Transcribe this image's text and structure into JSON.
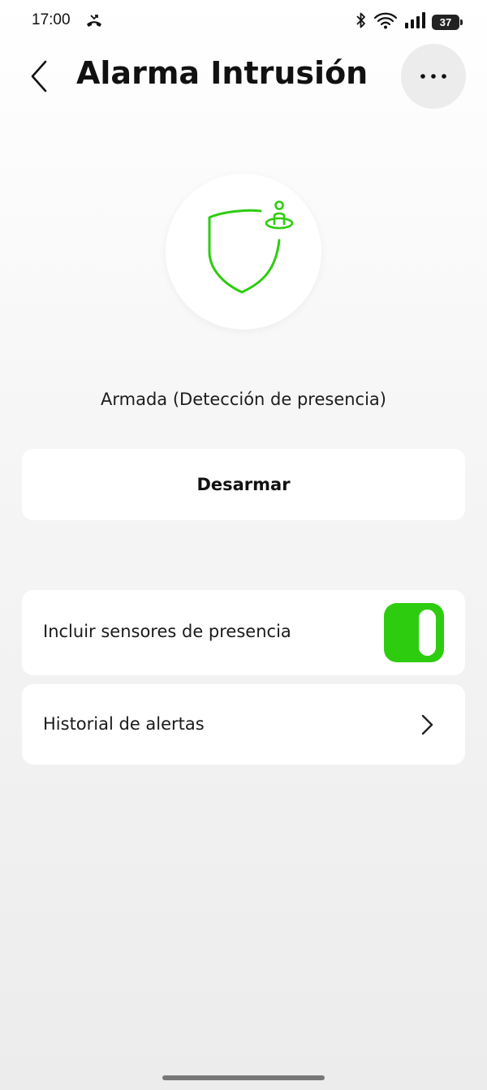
{
  "status_bar": {
    "time": "17:00",
    "battery_level": "37",
    "icons": [
      "missed-call-icon",
      "bluetooth-icon",
      "wifi-icon",
      "signal-icon",
      "battery-icon"
    ]
  },
  "header": {
    "title": "Alarma Intrusión",
    "back_icon": "chevron-left-icon",
    "more_icon": "more-dots-icon"
  },
  "hero": {
    "icon": "shield-presence-icon",
    "accent_color": "#2ecc0f",
    "status_text": "Armada (Detección de presencia)"
  },
  "actions": {
    "disarm_label": "Desarmar"
  },
  "settings": {
    "presence": {
      "label": "Incluir sensores de presencia",
      "enabled": true,
      "toggle_color": "#2ecc0f"
    },
    "history": {
      "label": "Historial de alertas",
      "icon": "chevron-right-icon"
    }
  }
}
